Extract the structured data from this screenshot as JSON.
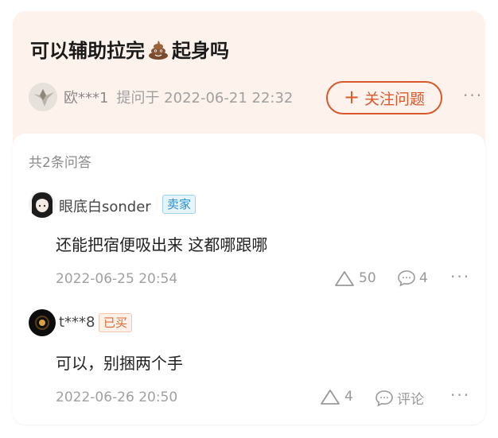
{
  "question": {
    "title_before": "可以辅助拉完",
    "title_icon": "poop-emoji-icon",
    "title_after": "起身吗",
    "asker_name": "欧***1",
    "asked_time": "提问于 2022-06-21 22:32",
    "follow_label": "关注问题",
    "follow_icon": "+"
  },
  "answers_summary": "共2条问答",
  "answers": [
    {
      "user": "眼底白sonder",
      "badge": "卖家",
      "content": "还能把宿便吸出来 这都哪跟哪",
      "date": "2022-06-25 20:54",
      "likes": "50",
      "comments": "4"
    },
    {
      "user": "t***8",
      "badge": "已买",
      "content": "可以，别捆两个手",
      "date": "2022-06-26 20:50",
      "likes": "4",
      "comments": "评论"
    }
  ],
  "colors": {
    "accent": "#d9592a",
    "question_bg": "#fdf2ec",
    "seller_badge": "#2a8fcf",
    "bought_badge": "#e2672f"
  },
  "more_label": "···"
}
